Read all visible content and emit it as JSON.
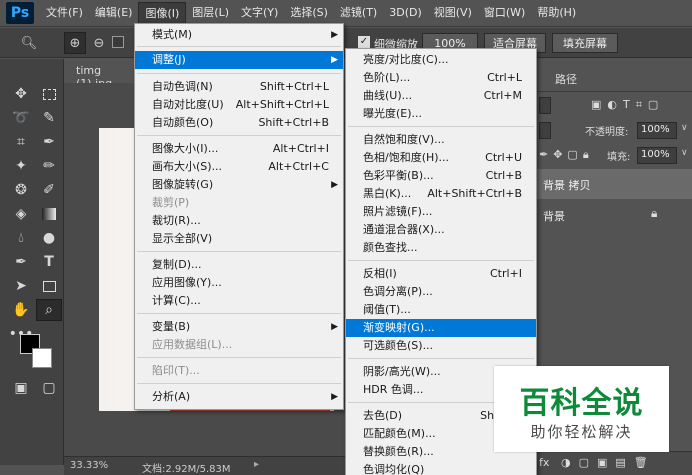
{
  "app": {
    "logo": "Ps"
  },
  "menubar": [
    {
      "label": "文件(F)"
    },
    {
      "label": "编辑(E)"
    },
    {
      "label": "图像(I)"
    },
    {
      "label": "图层(L)"
    },
    {
      "label": "文字(Y)"
    },
    {
      "label": "选择(S)"
    },
    {
      "label": "滤镜(T)"
    },
    {
      "label": "3D(D)"
    },
    {
      "label": "视图(V)"
    },
    {
      "label": "窗口(W)"
    },
    {
      "label": "帮助(H)"
    }
  ],
  "options": {
    "fine_zoom_label": "细微缩放",
    "zoom_value": "100%",
    "fit_screen_label": "适合屏幕",
    "fill_screen_label": "填充屏幕"
  },
  "document": {
    "tab_title": "timg (1).jpg"
  },
  "status": {
    "zoom": "33.33%",
    "doc_info": "文档:2.92M/5.83M"
  },
  "panel": {
    "tab_paths": "路径",
    "opacity_label": "不透明度:",
    "opacity_value": "100%",
    "fill_label": "填充:",
    "fill_value": "100%",
    "layers": [
      {
        "name": "背景 拷贝"
      },
      {
        "name": "背景"
      }
    ]
  },
  "image_menu": {
    "items": [
      {
        "label": "模式(M)",
        "shortcut": "",
        "submenu": true,
        "disabled": false
      },
      {
        "label": "调整(J)",
        "shortcut": "",
        "submenu": true,
        "disabled": false,
        "highlighted": true
      },
      {
        "label": "自动色调(N)",
        "shortcut": "Shift+Ctrl+L"
      },
      {
        "label": "自动对比度(U)",
        "shortcut": "Alt+Shift+Ctrl+L"
      },
      {
        "label": "自动颜色(O)",
        "shortcut": "Shift+Ctrl+B"
      },
      {
        "label": "图像大小(I)...",
        "shortcut": "Alt+Ctrl+I"
      },
      {
        "label": "画布大小(S)...",
        "shortcut": "Alt+Ctrl+C"
      },
      {
        "label": "图像旋转(G)",
        "shortcut": "",
        "submenu": true
      },
      {
        "label": "裁剪(P)",
        "shortcut": "",
        "disabled": true
      },
      {
        "label": "裁切(R)...",
        "shortcut": ""
      },
      {
        "label": "显示全部(V)",
        "shortcut": ""
      },
      {
        "label": "复制(D)...",
        "shortcut": ""
      },
      {
        "label": "应用图像(Y)...",
        "shortcut": ""
      },
      {
        "label": "计算(C)...",
        "shortcut": ""
      },
      {
        "label": "变量(B)",
        "shortcut": "",
        "submenu": true
      },
      {
        "label": "应用数据组(L)...",
        "shortcut": "",
        "disabled": true
      },
      {
        "label": "陷印(T)...",
        "shortcut": "",
        "disabled": true
      },
      {
        "label": "分析(A)",
        "shortcut": "",
        "submenu": true
      }
    ]
  },
  "adjust_menu": {
    "items": [
      {
        "label": "亮度/对比度(C)...",
        "shortcut": ""
      },
      {
        "label": "色阶(L)...",
        "shortcut": "Ctrl+L"
      },
      {
        "label": "曲线(U)...",
        "shortcut": "Ctrl+M"
      },
      {
        "label": "曝光度(E)...",
        "shortcut": ""
      },
      {
        "label": "自然饱和度(V)...",
        "shortcut": ""
      },
      {
        "label": "色相/饱和度(H)...",
        "shortcut": "Ctrl+U"
      },
      {
        "label": "色彩平衡(B)...",
        "shortcut": "Ctrl+B"
      },
      {
        "label": "黑白(K)...",
        "shortcut": "Alt+Shift+Ctrl+B"
      },
      {
        "label": "照片滤镜(F)...",
        "shortcut": ""
      },
      {
        "label": "通道混合器(X)...",
        "shortcut": ""
      },
      {
        "label": "颜色查找...",
        "shortcut": ""
      },
      {
        "label": "反相(I)",
        "shortcut": "Ctrl+I"
      },
      {
        "label": "色调分离(P)...",
        "shortcut": ""
      },
      {
        "label": "阈值(T)...",
        "shortcut": ""
      },
      {
        "label": "渐变映射(G)...",
        "shortcut": "",
        "highlighted": true
      },
      {
        "label": "可选颜色(S)...",
        "shortcut": ""
      },
      {
        "label": "阴影/高光(W)...",
        "shortcut": ""
      },
      {
        "label": "HDR 色调...",
        "shortcut": ""
      },
      {
        "label": "去色(D)",
        "shortcut": "Shift+C"
      },
      {
        "label": "匹配颜色(M)...",
        "shortcut": ""
      },
      {
        "label": "替换颜色(R)...",
        "shortcut": ""
      },
      {
        "label": "色调均化(Q)",
        "shortcut": ""
      }
    ]
  },
  "watermark": {
    "title": "百科全说",
    "subtitle": "助你轻松解决"
  },
  "colors": {
    "highlight": "#0078d7",
    "menu_bg": "#f0f0f0",
    "ui_dark": "#424242",
    "watermark_green": "#0f8a3a"
  }
}
